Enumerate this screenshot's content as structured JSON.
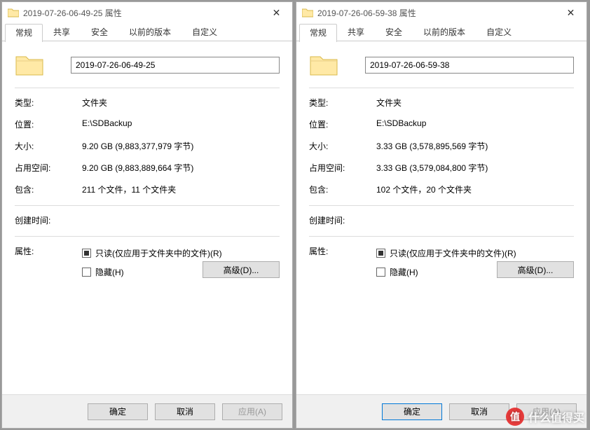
{
  "watermark": {
    "icon_char": "值",
    "text": "什么值得买"
  },
  "dialogs": [
    {
      "title": "2019-07-26-06-49-25 属性",
      "tabs": [
        "常规",
        "共享",
        "安全",
        "以前的版本",
        "自定义"
      ],
      "active_tab": 0,
      "name_value": "2019-07-26-06-49-25",
      "fields": {
        "type_label": "类型:",
        "type_value": "文件夹",
        "loc_label": "位置:",
        "loc_value": "E:\\SDBackup",
        "size_label": "大小:",
        "size_value": "9.20 GB (9,883,377,979 字节)",
        "disk_label": "占用空间:",
        "disk_value": "9.20 GB (9,883,889,664 字节)",
        "contains_label": "包含:",
        "contains_value": "211 个文件，11 个文件夹",
        "created_label": "创建时间:",
        "created_value": "",
        "attr_label": "属性:"
      },
      "readonly_label": "只读(仅应用于文件夹中的文件)(R)",
      "hidden_label": "隐藏(H)",
      "advanced_label": "高级(D)...",
      "buttons": {
        "ok": "确定",
        "cancel": "取消",
        "apply": "应用(A)"
      },
      "apply_enabled": false,
      "ok_primary": false
    },
    {
      "title": "2019-07-26-06-59-38 属性",
      "tabs": [
        "常规",
        "共享",
        "安全",
        "以前的版本",
        "自定义"
      ],
      "active_tab": 0,
      "name_value": "2019-07-26-06-59-38",
      "fields": {
        "type_label": "类型:",
        "type_value": "文件夹",
        "loc_label": "位置:",
        "loc_value": "E:\\SDBackup",
        "size_label": "大小:",
        "size_value": "3.33 GB (3,578,895,569 字节)",
        "disk_label": "占用空间:",
        "disk_value": "3.33 GB (3,579,084,800 字节)",
        "contains_label": "包含:",
        "contains_value": "102 个文件，20 个文件夹",
        "created_label": "创建时间:",
        "created_value": "",
        "attr_label": "属性:"
      },
      "readonly_label": "只读(仅应用于文件夹中的文件)(R)",
      "hidden_label": "隐藏(H)",
      "advanced_label": "高级(D)...",
      "buttons": {
        "ok": "确定",
        "cancel": "取消",
        "apply": "应用(A)"
      },
      "apply_enabled": false,
      "ok_primary": true
    }
  ]
}
